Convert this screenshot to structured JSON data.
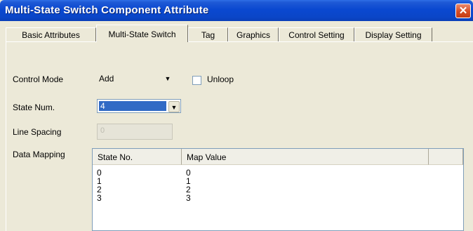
{
  "window": {
    "title": "Multi-State Switch Component Attribute",
    "close_label": "✕"
  },
  "tabs": [
    {
      "label": "Basic Attributes",
      "active": false
    },
    {
      "label": "Multi-State Switch",
      "active": true
    },
    {
      "label": "Tag",
      "active": false
    },
    {
      "label": "Graphics",
      "active": false
    },
    {
      "label": "Control Setting",
      "active": false
    },
    {
      "label": "Display Setting",
      "active": false
    }
  ],
  "form": {
    "control_mode": {
      "label": "Control Mode",
      "value": "Add"
    },
    "unloop": {
      "label": "Unloop",
      "checked": false
    },
    "state_num": {
      "label": "State Num.",
      "value": "4"
    },
    "line_spacing": {
      "label": "Line Spacing",
      "value": "0"
    },
    "data_mapping_label": "Data Mapping"
  },
  "table": {
    "columns": [
      "State No.",
      "Map Value"
    ],
    "rows": [
      [
        "0",
        "0"
      ],
      [
        "1",
        "1"
      ],
      [
        "2",
        "2"
      ],
      [
        "3",
        "3"
      ]
    ]
  },
  "colors": {
    "titlebar": "#0a48d0",
    "selection": "#316ac5",
    "dialog_bg": "#ece9d8"
  },
  "icons": {
    "dropdown": "chevron-down-icon",
    "close": "close-icon"
  }
}
